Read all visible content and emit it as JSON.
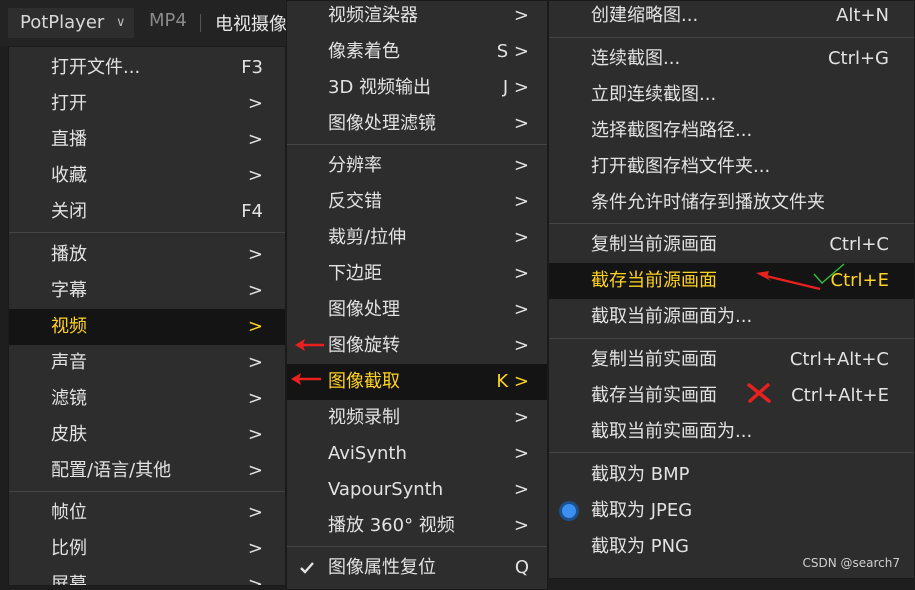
{
  "titlebar": {
    "app_name": "PotPlayer",
    "format": "MP4",
    "title": "电视摄像"
  },
  "menu_main": {
    "items": [
      {
        "label": "打开文件...",
        "shortcut": "F3"
      },
      {
        "label": "打开",
        "shortcut": ">"
      },
      {
        "label": "直播",
        "shortcut": ">"
      },
      {
        "label": "收藏",
        "shortcut": ">"
      },
      {
        "label": "关闭",
        "shortcut": "F4"
      },
      {
        "label": "播放",
        "shortcut": ">"
      },
      {
        "label": "字幕",
        "shortcut": ">"
      },
      {
        "label": "视频",
        "shortcut": ">"
      },
      {
        "label": "声音",
        "shortcut": ">"
      },
      {
        "label": "滤镜",
        "shortcut": ">"
      },
      {
        "label": "皮肤",
        "shortcut": ">"
      },
      {
        "label": "配置/语言/其他",
        "shortcut": ">"
      },
      {
        "label": "帧位",
        "shortcut": ">"
      },
      {
        "label": "比例",
        "shortcut": ">"
      },
      {
        "label": "屏幕",
        "shortcut": ">"
      }
    ]
  },
  "menu_video": {
    "items": [
      {
        "label": "视频渲染器",
        "shortcut": ">"
      },
      {
        "label": "像素着色",
        "shortcut": "S >"
      },
      {
        "label": "3D 视频输出",
        "shortcut": "J >"
      },
      {
        "label": "图像处理滤镜",
        "shortcut": ">"
      },
      {
        "label": "分辨率",
        "shortcut": ">"
      },
      {
        "label": "反交错",
        "shortcut": ">"
      },
      {
        "label": "裁剪/拉伸",
        "shortcut": ">"
      },
      {
        "label": "下边距",
        "shortcut": ">"
      },
      {
        "label": "图像处理",
        "shortcut": ">"
      },
      {
        "label": "图像旋转",
        "shortcut": ">"
      },
      {
        "label": "图像截取",
        "shortcut": "K >"
      },
      {
        "label": "视频录制",
        "shortcut": ">"
      },
      {
        "label": "AviSynth",
        "shortcut": ">"
      },
      {
        "label": "VapourSynth",
        "shortcut": ">"
      },
      {
        "label": "播放 360° 视频",
        "shortcut": ">"
      },
      {
        "label": "图像属性复位",
        "shortcut": "Q"
      }
    ]
  },
  "menu_capture": {
    "items": [
      {
        "label": "创建缩略图...",
        "shortcut": "Alt+N"
      },
      {
        "label": "连续截图...",
        "shortcut": "Ctrl+G"
      },
      {
        "label": "立即连续截图...",
        "shortcut": ""
      },
      {
        "label": "选择截图存档路径...",
        "shortcut": ""
      },
      {
        "label": "打开截图存档文件夹...",
        "shortcut": ""
      },
      {
        "label": "条件允许时储存到播放文件夹",
        "shortcut": ""
      },
      {
        "label": "复制当前源画面",
        "shortcut": "Ctrl+C"
      },
      {
        "label": "截存当前源画面",
        "shortcut": "Ctrl+E"
      },
      {
        "label": "截取当前源画面为...",
        "shortcut": ""
      },
      {
        "label": "复制当前实画面",
        "shortcut": "Ctrl+Alt+C"
      },
      {
        "label": "截存当前实画面",
        "shortcut": "Ctrl+Alt+E"
      },
      {
        "label": "截取当前实画面为...",
        "shortcut": ""
      },
      {
        "label": "截取为 BMP",
        "shortcut": ""
      },
      {
        "label": "截取为 JPEG",
        "shortcut": ""
      },
      {
        "label": "截取为 PNG",
        "shortcut": ""
      }
    ]
  },
  "watermark": "CSDN @search7",
  "colors": {
    "highlight_text": "#ffd21e",
    "annotation_red": "#e8201e",
    "annotation_green": "#2fbf3a"
  }
}
